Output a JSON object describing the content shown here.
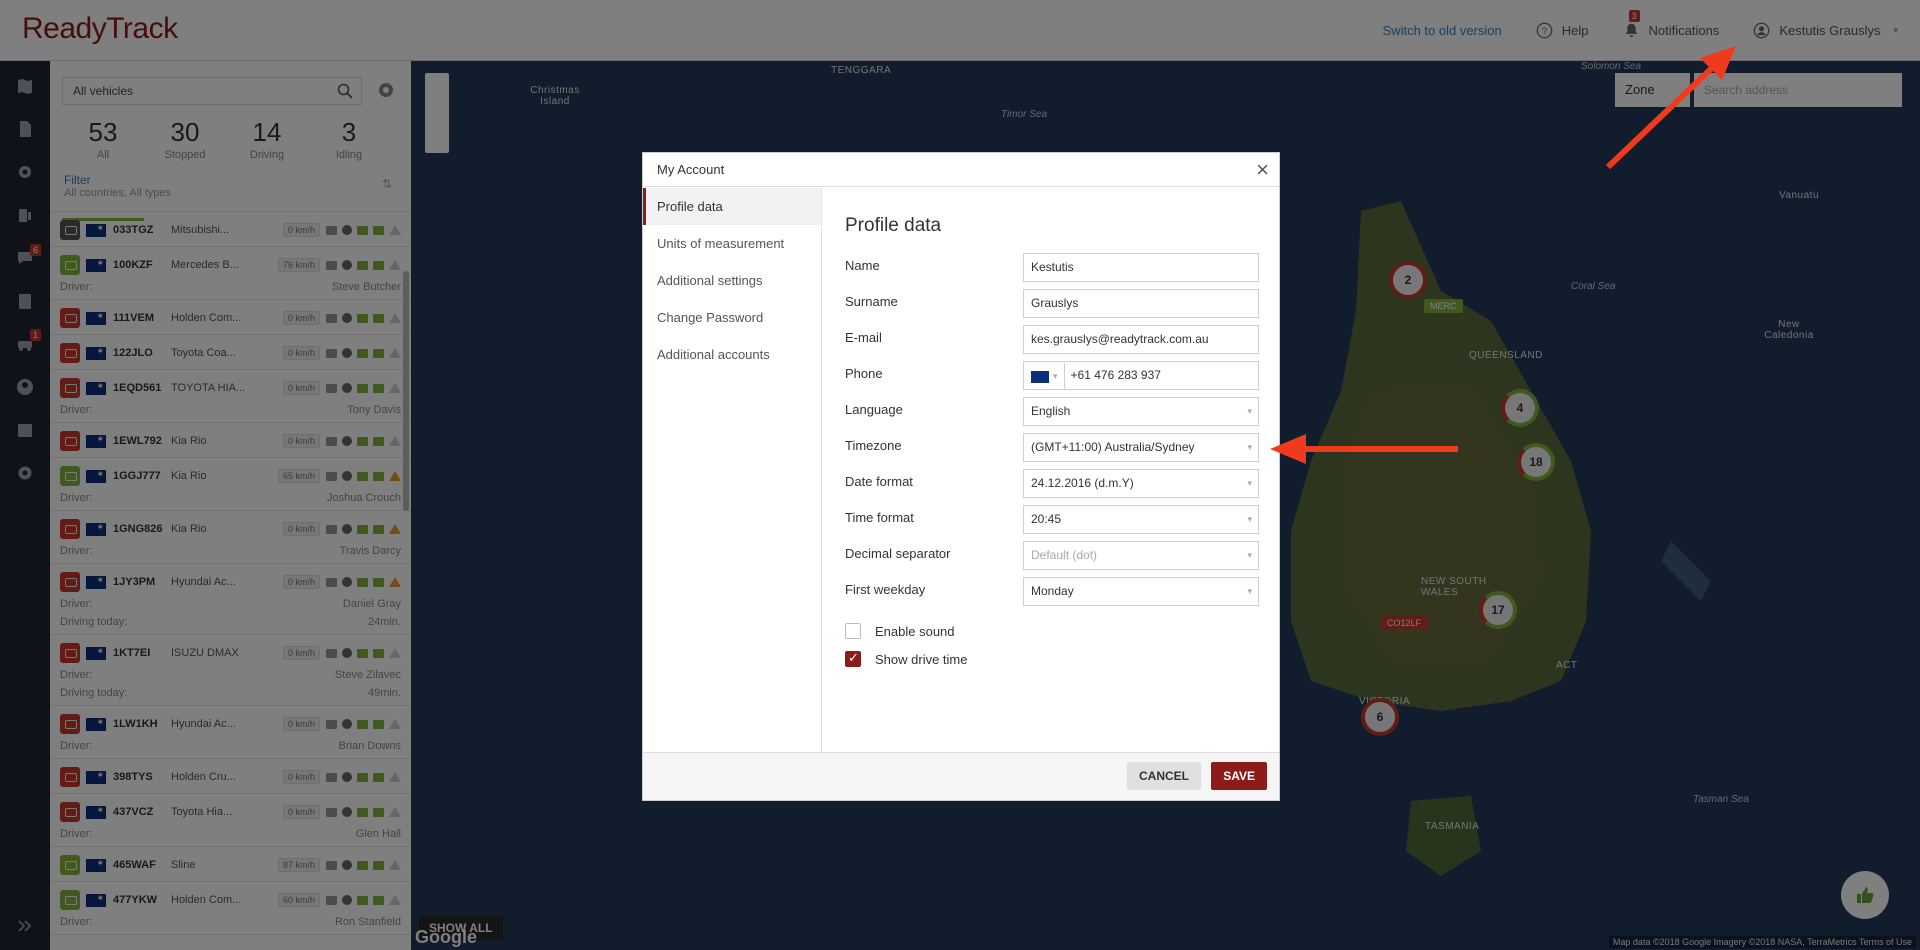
{
  "header": {
    "logo": "ReadyTrack",
    "switch_old": "Switch to old version",
    "help": "Help",
    "notifications": "Notifications",
    "notifications_count": "3",
    "user": "Kestutis Grauslys"
  },
  "rail": {
    "badge_messages": "6",
    "badge_drivers": "1"
  },
  "panel": {
    "search_value": "All vehicles",
    "stats": [
      {
        "num": "53",
        "label": "All"
      },
      {
        "num": "30",
        "label": "Stopped"
      },
      {
        "num": "14",
        "label": "Driving"
      },
      {
        "num": "3",
        "label": "Idling"
      }
    ],
    "filter_title": "Filter",
    "filter_sub": "All countries, All types",
    "vehicles": [
      {
        "plate": "033TGZ",
        "model": "Mitsubishi...",
        "speed": "0 km/h",
        "color": "dark",
        "driver": "",
        "driving": "",
        "warn": false
      },
      {
        "plate": "100KZF",
        "model": "Mercedes B...",
        "speed": "76 km/h",
        "color": "green",
        "driver": "Steve Butcher",
        "driving": "",
        "warn": false
      },
      {
        "plate": "111VEM",
        "model": "Holden Com...",
        "speed": "0 km/h",
        "color": "red",
        "driver": "",
        "driving": "",
        "warn": false
      },
      {
        "plate": "122JLO",
        "model": "Toyota Coa...",
        "speed": "0 km/h",
        "color": "red",
        "driver": "",
        "driving": "",
        "warn": false
      },
      {
        "plate": "1EQD561",
        "model": "TOYOTA HIA...",
        "speed": "0 km/h",
        "color": "red",
        "driver": "Tony Davis",
        "driving": "",
        "warn": false
      },
      {
        "plate": "1EWL792",
        "model": "Kia Rio",
        "speed": "0 km/h",
        "color": "red",
        "driver": "",
        "driving": "",
        "warn": false
      },
      {
        "plate": "1GGJ777",
        "model": "Kia Rio",
        "speed": "65 km/h",
        "color": "green",
        "driver": "Joshua Crouch",
        "driving": "",
        "warn": true
      },
      {
        "plate": "1GNG826",
        "model": "Kia Rio",
        "speed": "0 km/h",
        "color": "red",
        "driver": "Travis Darcy",
        "driving": "",
        "warn": true
      },
      {
        "plate": "1JY3PM",
        "model": "Hyundai Ac...",
        "speed": "0 km/h",
        "color": "red",
        "driver": "Daniel Gray",
        "driving": "24min.",
        "warn": true
      },
      {
        "plate": "1KT7EI",
        "model": "ISUZU DMAX",
        "speed": "0 km/h",
        "color": "red",
        "driver": "Steve Zilavec",
        "driving": "49min.",
        "warn": false
      },
      {
        "plate": "1LW1KH",
        "model": "Hyundai Ac...",
        "speed": "0 km/h",
        "color": "red",
        "driver": "Brian Downs",
        "driving": "",
        "warn": false
      },
      {
        "plate": "398TYS",
        "model": "Holden Cru...",
        "speed": "0 km/h",
        "color": "red",
        "driver": "",
        "driving": "",
        "warn": false
      },
      {
        "plate": "437VCZ",
        "model": "Toyota Hia...",
        "speed": "0 km/h",
        "color": "red",
        "driver": "Glen Hall",
        "driving": "",
        "warn": false
      },
      {
        "plate": "465WAF",
        "model": "Sline",
        "speed": "87 km/h",
        "color": "green",
        "driver": "",
        "driving": "",
        "warn": false
      },
      {
        "plate": "477YKW",
        "model": "Holden Com...",
        "speed": "60 km/h",
        "color": "green",
        "driver": "Ron Stanfield",
        "driving": "",
        "warn": false
      }
    ],
    "driver_label": "Driver:",
    "driving_label": "Driving today:"
  },
  "map": {
    "zone": "Zone",
    "search_placeholder": "Search address",
    "show_all": "SHOW ALL",
    "google": "Google",
    "attribution": "Map data ©2018 Google Imagery ©2018 NASA, TerraMetrics   Terms of Use",
    "labels": {
      "queensland": "QUEENSLAND",
      "nsw": "NEW SOUTH WALES",
      "act": "ACT",
      "victoria": "VICTORIA",
      "tasmania": "TASMANIA",
      "christmas": "Christmas Island",
      "timor": "Timor Sea",
      "coral": "Coral Sea",
      "tasman": "Tasman Sea",
      "vanuatu": "Vanuatu",
      "caledonia": "New Caledonia",
      "solomon": "Solomon Sea",
      "tenggara": "TENGGARA"
    },
    "clusters": [
      "2",
      "4",
      "18",
      "17",
      "6"
    ],
    "vehicle_tags": [
      "MERC",
      "CO12LF"
    ]
  },
  "modal": {
    "title": "My Account",
    "nav": [
      "Profile data",
      "Units of measurement",
      "Additional settings",
      "Change Password",
      "Additional accounts"
    ],
    "section_title": "Profile data",
    "fields": {
      "name_label": "Name",
      "name_value": "Kestutis",
      "surname_label": "Surname",
      "surname_value": "Grauslys",
      "email_label": "E-mail",
      "email_value": "kes.grauslys@readytrack.com.au",
      "phone_label": "Phone",
      "phone_value": "+61 476 283 937",
      "language_label": "Language",
      "language_value": "English",
      "timezone_label": "Timezone",
      "timezone_value": "(GMT+11:00) Australia/Sydney",
      "date_label": "Date format",
      "date_value": "24.12.2016 (d.m.Y)",
      "time_label": "Time format",
      "time_value": "20:45",
      "decimal_label": "Decimal separator",
      "decimal_value": "Default (dot)",
      "weekday_label": "First weekday",
      "weekday_value": "Monday"
    },
    "enable_sound": "Enable sound",
    "enable_sound_checked": false,
    "show_drive_time": "Show drive time",
    "show_drive_time_checked": true,
    "cancel": "CANCEL",
    "save": "SAVE"
  },
  "colors": {
    "brand": "#8c1b1b",
    "link": "#2e7fc1",
    "green": "#7fb33f",
    "red": "#c0392b",
    "arrow": "#f03a1e"
  }
}
